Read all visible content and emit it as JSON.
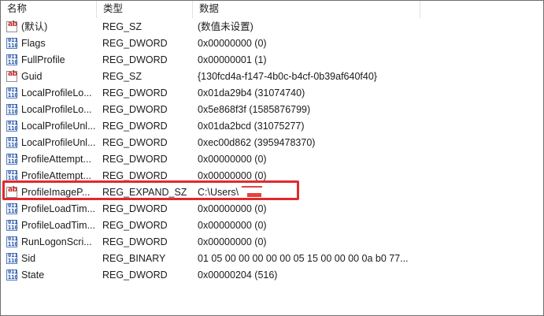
{
  "header": {
    "name_label": "名称",
    "type_label": "类型",
    "data_label": "数据"
  },
  "rows": [
    {
      "icon": "string-value-icon",
      "name": "(默认)",
      "type": "REG_SZ",
      "data": "(数值未设置)"
    },
    {
      "icon": "binary-value-icon",
      "name": "Flags",
      "type": "REG_DWORD",
      "data": "0x00000000 (0)"
    },
    {
      "icon": "binary-value-icon",
      "name": "FullProfile",
      "type": "REG_DWORD",
      "data": "0x00000001 (1)"
    },
    {
      "icon": "string-value-icon",
      "name": "Guid",
      "type": "REG_SZ",
      "data": "{130fcd4a-f147-4b0c-b4cf-0b39af640f40}"
    },
    {
      "icon": "binary-value-icon",
      "name": "LocalProfileLo...",
      "type": "REG_DWORD",
      "data": "0x01da29b4 (31074740)"
    },
    {
      "icon": "binary-value-icon",
      "name": "LocalProfileLo...",
      "type": "REG_DWORD",
      "data": "0x5e868f3f (1585876799)"
    },
    {
      "icon": "binary-value-icon",
      "name": "LocalProfileUnl...",
      "type": "REG_DWORD",
      "data": "0x01da2bcd (31075277)"
    },
    {
      "icon": "binary-value-icon",
      "name": "LocalProfileUnl...",
      "type": "REG_DWORD",
      "data": "0xec00d862 (3959478370)"
    },
    {
      "icon": "binary-value-icon",
      "name": "ProfileAttempt...",
      "type": "REG_DWORD",
      "data": "0x00000000 (0)"
    },
    {
      "icon": "binary-value-icon",
      "name": "ProfileAttempt...",
      "type": "REG_DWORD",
      "data": "0x00000000 (0)"
    },
    {
      "icon": "string-value-icon",
      "name": "ProfileImageP...",
      "type": "REG_EXPAND_SZ",
      "data": "C:\\Users\\",
      "highlighted": true
    },
    {
      "icon": "binary-value-icon",
      "name": "ProfileLoadTim...",
      "type": "REG_DWORD",
      "data": "0x00000000 (0)"
    },
    {
      "icon": "binary-value-icon",
      "name": "ProfileLoadTim...",
      "type": "REG_DWORD",
      "data": "0x00000000 (0)"
    },
    {
      "icon": "binary-value-icon",
      "name": "RunLogonScri...",
      "type": "REG_DWORD",
      "data": "0x00000000 (0)"
    },
    {
      "icon": "binary-value-icon",
      "name": "Sid",
      "type": "REG_BINARY",
      "data": "01 05 00 00 00 00 00 05 15 00 00 00 0a b0 77..."
    },
    {
      "icon": "binary-value-icon",
      "name": "State",
      "type": "REG_DWORD",
      "data": "0x00000204 (516)"
    }
  ],
  "icons": {
    "string_glyph": "ab",
    "binary_glyph_top": "011",
    "binary_glyph_bottom": "110"
  },
  "colors": {
    "highlight_border": "#e02a2e",
    "string_icon": "#c4261f",
    "binary_icon": "#2855a8"
  }
}
